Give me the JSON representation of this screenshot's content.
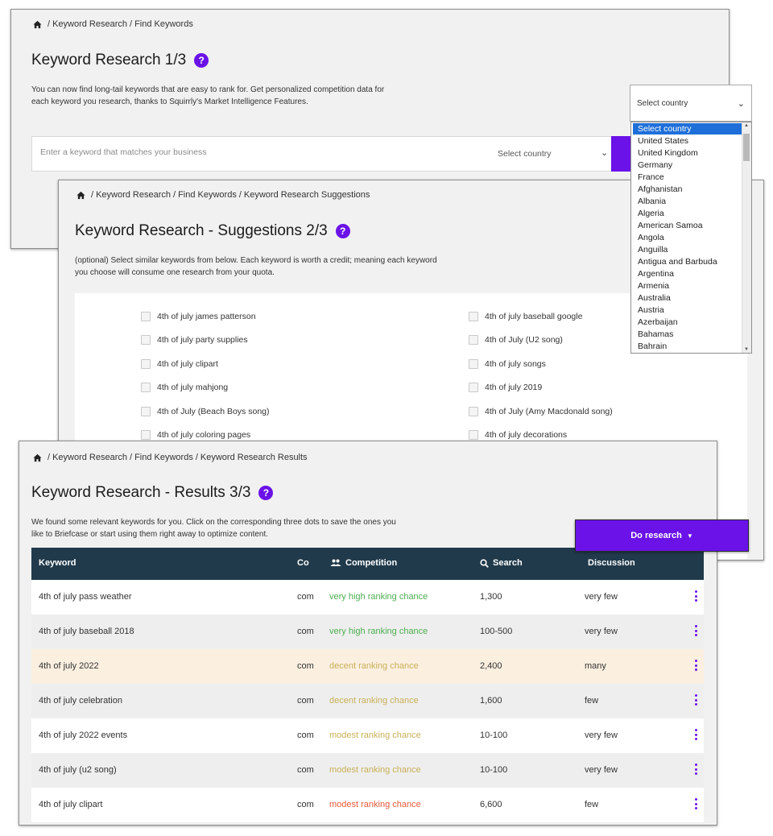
{
  "colors": {
    "accent": "#6a12e8",
    "table_header": "#203a4b",
    "high": "#4caf50",
    "decent": "#c9b057",
    "modest": "#c9b057",
    "modest_low": "#e65a3a"
  },
  "step1": {
    "breadcrumb": [
      "Keyword Research",
      "Find Keywords"
    ],
    "title": "Keyword Research 1/3",
    "help": "?",
    "description_line1": "You can now find long-tail keywords that are easy to rank for. Get personalized competition data for",
    "description_line2": "each keyword you research, thanks to Squirrly's Market Intelligence Features.",
    "keyword_placeholder": "Enter a keyword that matches your business",
    "country_label": "Select country",
    "dropdown": {
      "selected": "Select country",
      "options": [
        "Select country",
        "United States",
        "United Kingdom",
        "Germany",
        "France",
        "Afghanistan",
        "Albania",
        "Algeria",
        "American Samoa",
        "Angola",
        "Anguilla",
        "Antigua and Barbuda",
        "Argentina",
        "Armenia",
        "Australia",
        "Austria",
        "Azerbaijan",
        "Bahamas",
        "Bahrain"
      ]
    }
  },
  "step2": {
    "breadcrumb": [
      "Keyword Research",
      "Find Keywords",
      "Keyword Research Suggestions"
    ],
    "title": "Keyword Research - Suggestions 2/3",
    "help": "?",
    "description_line1": "(optional) Select similar keywords from below. Each keyword is worth a credit; meaning each keyword",
    "description_line2": "you choose will consume one research from your quota.",
    "suggestions_left": [
      "4th of july james patterson",
      "4th of july party supplies",
      "4th of july clipart",
      "4th of july mahjong",
      "4th of July (Beach Boys song)",
      "4th of july coloring pages"
    ],
    "suggestions_right": [
      "4th of july baseball google",
      "4th of July (U2 song)",
      "4th of july songs",
      "4th of july 2019",
      "4th of July (Amy Macdonald song)",
      "4th of july decorations"
    ]
  },
  "step3": {
    "breadcrumb": [
      "Keyword Research",
      "Find Keywords",
      "Keyword Research Results"
    ],
    "title": "Keyword Research - Results 3/3",
    "help": "?",
    "description_line1": "We found some relevant keywords for you. Click on the corresponding three dots to save the ones you",
    "description_line2": "like to Briefcase or start using them right away to optimize content.",
    "do_research": "Do research",
    "columns": {
      "keyword": "Keyword",
      "co": "Co",
      "competition": "Competition",
      "search": "Search",
      "discussion": "Discussion"
    },
    "rows": [
      {
        "keyword": "4th of july pass weather",
        "co": "com",
        "competition": "very high ranking chance",
        "level": "high",
        "search": "1,300",
        "discussion": "very few"
      },
      {
        "keyword": "4th of july baseball 2018",
        "co": "com",
        "competition": "very high ranking chance",
        "level": "high",
        "search": "100-500",
        "discussion": "very few"
      },
      {
        "keyword": "4th of july 2022",
        "co": "com",
        "competition": "decent ranking chance",
        "level": "decent",
        "search": "2,400",
        "discussion": "many",
        "highlight": true
      },
      {
        "keyword": "4th of july celebration",
        "co": "com",
        "competition": "decent ranking chance",
        "level": "decent",
        "search": "1,600",
        "discussion": "few"
      },
      {
        "keyword": "4th of july 2022 events",
        "co": "com",
        "competition": "modest ranking chance",
        "level": "modest",
        "search": "10-100",
        "discussion": "very few"
      },
      {
        "keyword": "4th of july (u2 song)",
        "co": "com",
        "competition": "modest ranking chance",
        "level": "modest",
        "search": "10-100",
        "discussion": "very few"
      },
      {
        "keyword": "4th of july clipart",
        "co": "com",
        "competition": "modest ranking chance",
        "level": "modest_low",
        "search": "6,600",
        "discussion": "few"
      }
    ]
  }
}
